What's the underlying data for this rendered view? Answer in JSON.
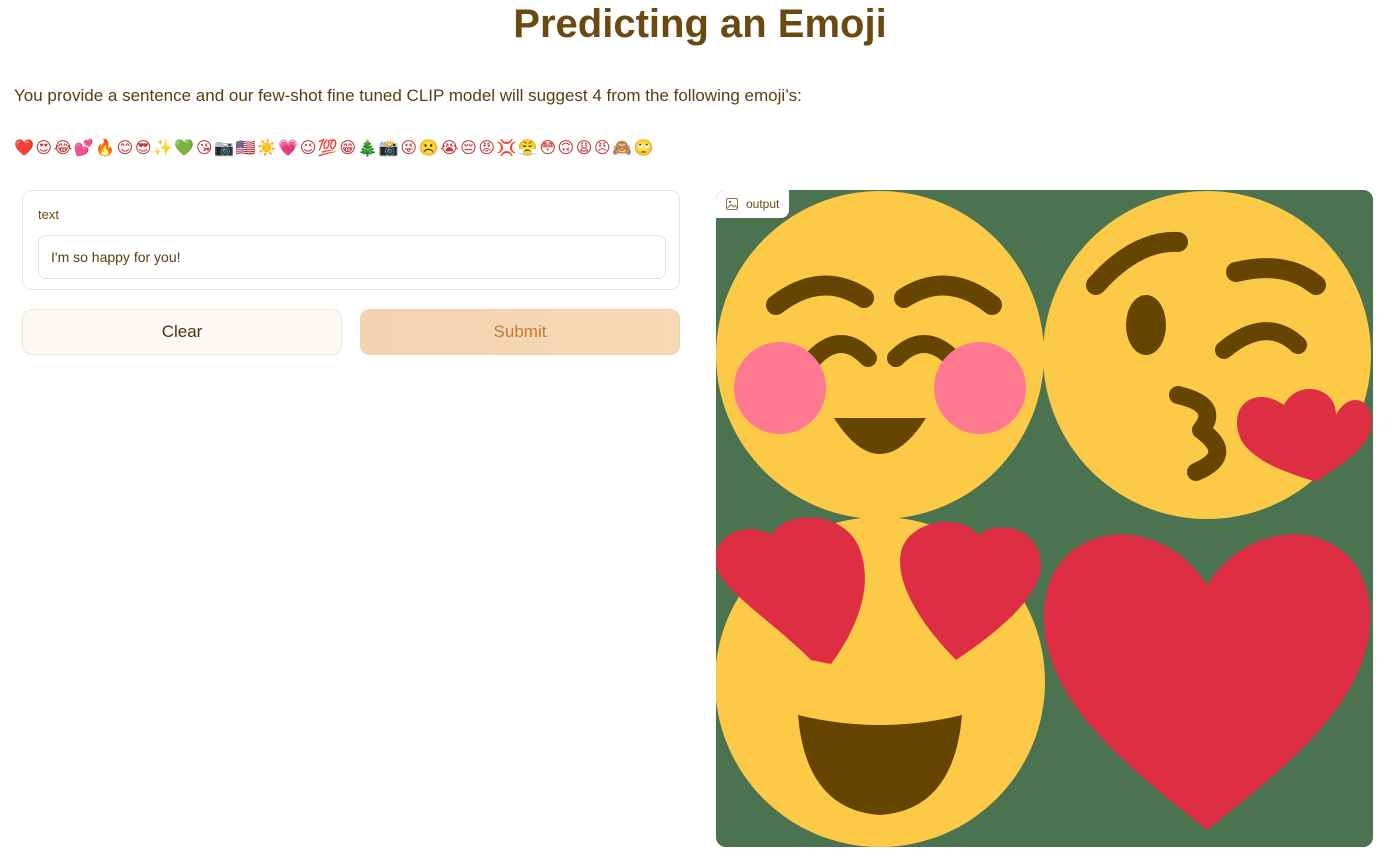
{
  "header": {
    "title": "Predicting an Emoji"
  },
  "description": "You provide a sentence and our few-shot fine tuned CLIP model will suggest 4 from the following emoji’s:",
  "emoji_strip": "❤️😍😂💕🔥😊😎✨💚😘📷🇺🇸☀️💗😉💯😁🎄📸😜☹️😭😔😡💢😤😳🙃😩😠🙈🙄",
  "text_input": {
    "label": "text",
    "value": "I'm so happy for you!"
  },
  "buttons": {
    "clear": "Clear",
    "submit": "Submit"
  },
  "output": {
    "label": "output",
    "icon": "image-icon",
    "predicted_emojis": [
      "smiling-face-with-smiling-eyes",
      "face-blowing-a-kiss",
      "smiling-face-with-heart-eyes",
      "red-heart"
    ],
    "colors": {
      "background": "#4b7350",
      "face": "#fdca47",
      "feature": "#664500",
      "heart": "#dd2e44",
      "blush": "#ff7892"
    }
  }
}
